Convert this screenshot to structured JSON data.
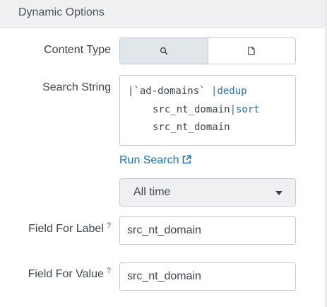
{
  "panel": {
    "title": "Dynamic Options"
  },
  "content_type": {
    "label": "Content Type",
    "options": [
      {
        "icon": "search-icon",
        "active": true
      },
      {
        "icon": "document-icon",
        "active": false
      }
    ]
  },
  "search_string": {
    "label": "Search String",
    "code": [
      {
        "pre": "|`ad-domains` ",
        "kw": "|dedup"
      },
      {
        "pre": "src_nt_domain",
        "kw": "|sort"
      },
      {
        "pre": "src_nt_domain",
        "kw": ""
      }
    ]
  },
  "run_search": {
    "label": "Run Search",
    "icon": "external-link-icon"
  },
  "time_range": {
    "value": "All time"
  },
  "field_for_label": {
    "label": "Field For Label",
    "help": "?",
    "value": "src_nt_domain"
  },
  "field_for_value": {
    "label": "Field For Value",
    "help": "?",
    "value": "src_nt_domain"
  },
  "colors": {
    "link": "#1a73ad",
    "keyword": "#2e6fb5",
    "header_bg": "#eef0f2",
    "border": "#c3cbd4"
  }
}
